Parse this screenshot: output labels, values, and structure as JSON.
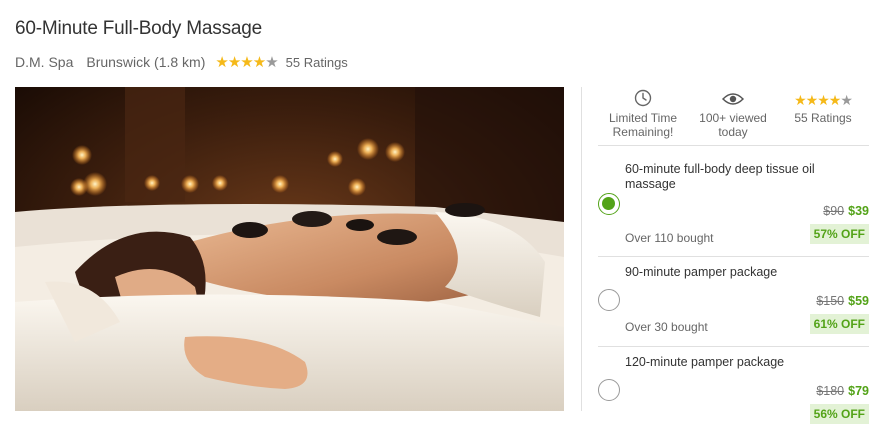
{
  "deal": {
    "title": "60-Minute Full-Body Massage",
    "merchant": "D.M. Spa",
    "location": "Brunswick (1.8 km)",
    "rating_value": 4,
    "rating_max": 5,
    "ratings_label": "55 Ratings"
  },
  "stats": {
    "limited_time_line1": "Limited Time",
    "limited_time_line2": "Remaining!",
    "viewed_line1": "100+ viewed",
    "viewed_line2": "today",
    "ratings_label": "55 Ratings"
  },
  "options": [
    {
      "title": "60-minute full-body deep tissue oil massage",
      "bought": "Over 110 bought",
      "original_price": "$90",
      "sale_price": "$39",
      "discount": "57% OFF",
      "selected": true
    },
    {
      "title": "90-minute pamper package",
      "bought": "Over 30 bought",
      "original_price": "$150",
      "sale_price": "$59",
      "discount": "61% OFF",
      "selected": false
    },
    {
      "title": "120-minute pamper package",
      "bought": "",
      "original_price": "$180",
      "sale_price": "$79",
      "discount": "56% OFF",
      "selected": false
    }
  ],
  "colors": {
    "star": "#f5b919",
    "accent_green": "#53a318",
    "badge_bg": "#e3f2d6"
  },
  "icons": {
    "clock": "clock-icon",
    "eye": "eye-icon",
    "star": "star-icon",
    "radio": "radio-button"
  }
}
